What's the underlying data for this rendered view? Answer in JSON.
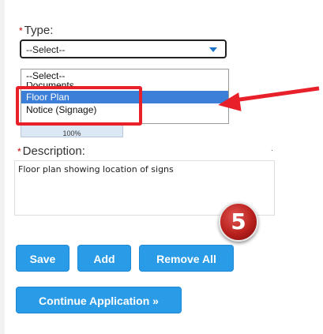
{
  "type_field": {
    "required_mark": "*",
    "label": "Type:",
    "selected_value": "--Select--",
    "options": [
      "--Select--",
      "Documents",
      "Floor Plan",
      "Notice (Signage)"
    ],
    "highlighted_option": "Floor Plan"
  },
  "hidden_box_text": "100%",
  "description_field": {
    "required_mark": "*",
    "label": "Description:",
    "value": "Floor plan showing location of signs"
  },
  "step_badge": "5",
  "buttons": {
    "save": "Save",
    "add": "Add",
    "remove_all": "Remove All",
    "continue": "Continue Application »"
  },
  "colors": {
    "button_blue": "#2a9be6",
    "highlight_blue": "#3c7fd8",
    "annotation_red": "#e8202a"
  }
}
